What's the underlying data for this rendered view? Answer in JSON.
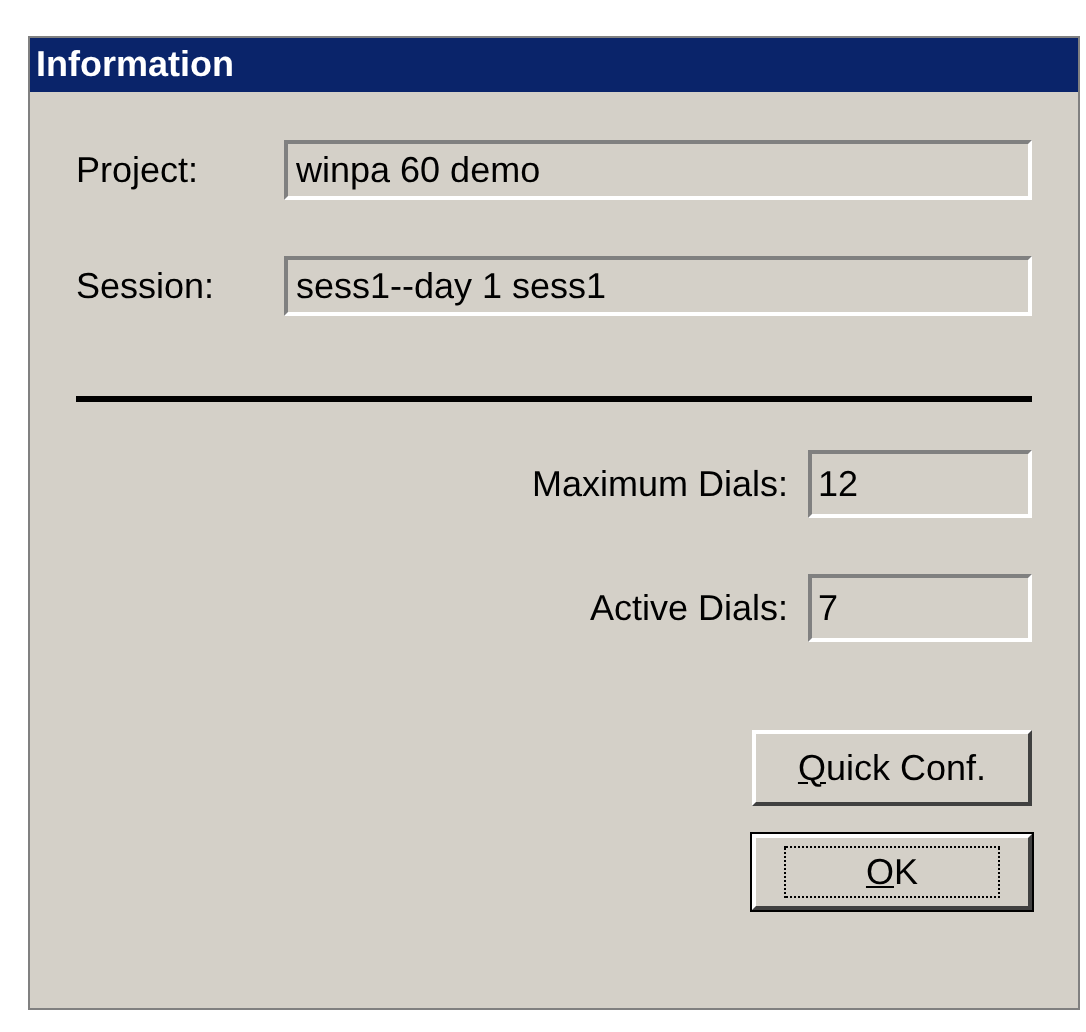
{
  "window": {
    "title": "Information"
  },
  "fields": [
    {
      "label": "Project:",
      "value": "winpa 60 demo"
    },
    {
      "label": "Session:",
      "value": "sess1--day 1 sess1"
    }
  ],
  "dials": [
    {
      "label": "Maximum Dials:",
      "value": "12"
    },
    {
      "label": "Active Dials:",
      "value": "7"
    }
  ],
  "buttons": [
    {
      "label": "Quick Conf.",
      "access_key_underlined": true,
      "focused": false
    },
    {
      "label": "OK",
      "access_key_underlined": true,
      "focused": true
    }
  ]
}
